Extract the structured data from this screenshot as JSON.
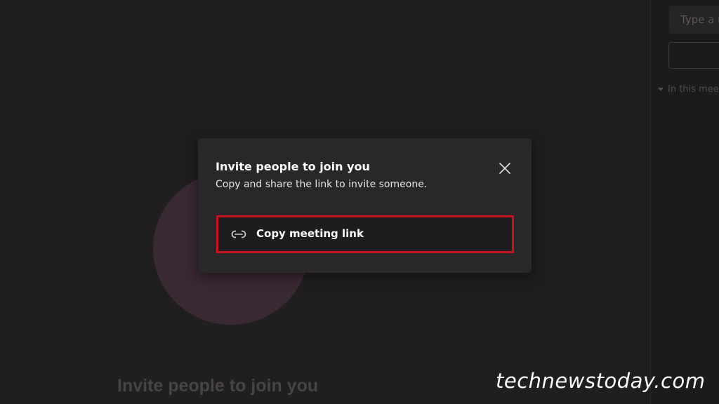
{
  "side_panel": {
    "search_placeholder": "Type a n",
    "section_label": "In this meet"
  },
  "stage": {
    "caption": "Invite people to join you"
  },
  "invite_dialog": {
    "title": "Invite people to join you",
    "subtitle": "Copy and share the link to invite someone.",
    "copy_link_label": "Copy meeting link",
    "close_icon": "close-icon",
    "link_icon": "link-icon",
    "highlight_color": "#c8141c"
  },
  "watermark": {
    "text": "technewstoday.com"
  }
}
